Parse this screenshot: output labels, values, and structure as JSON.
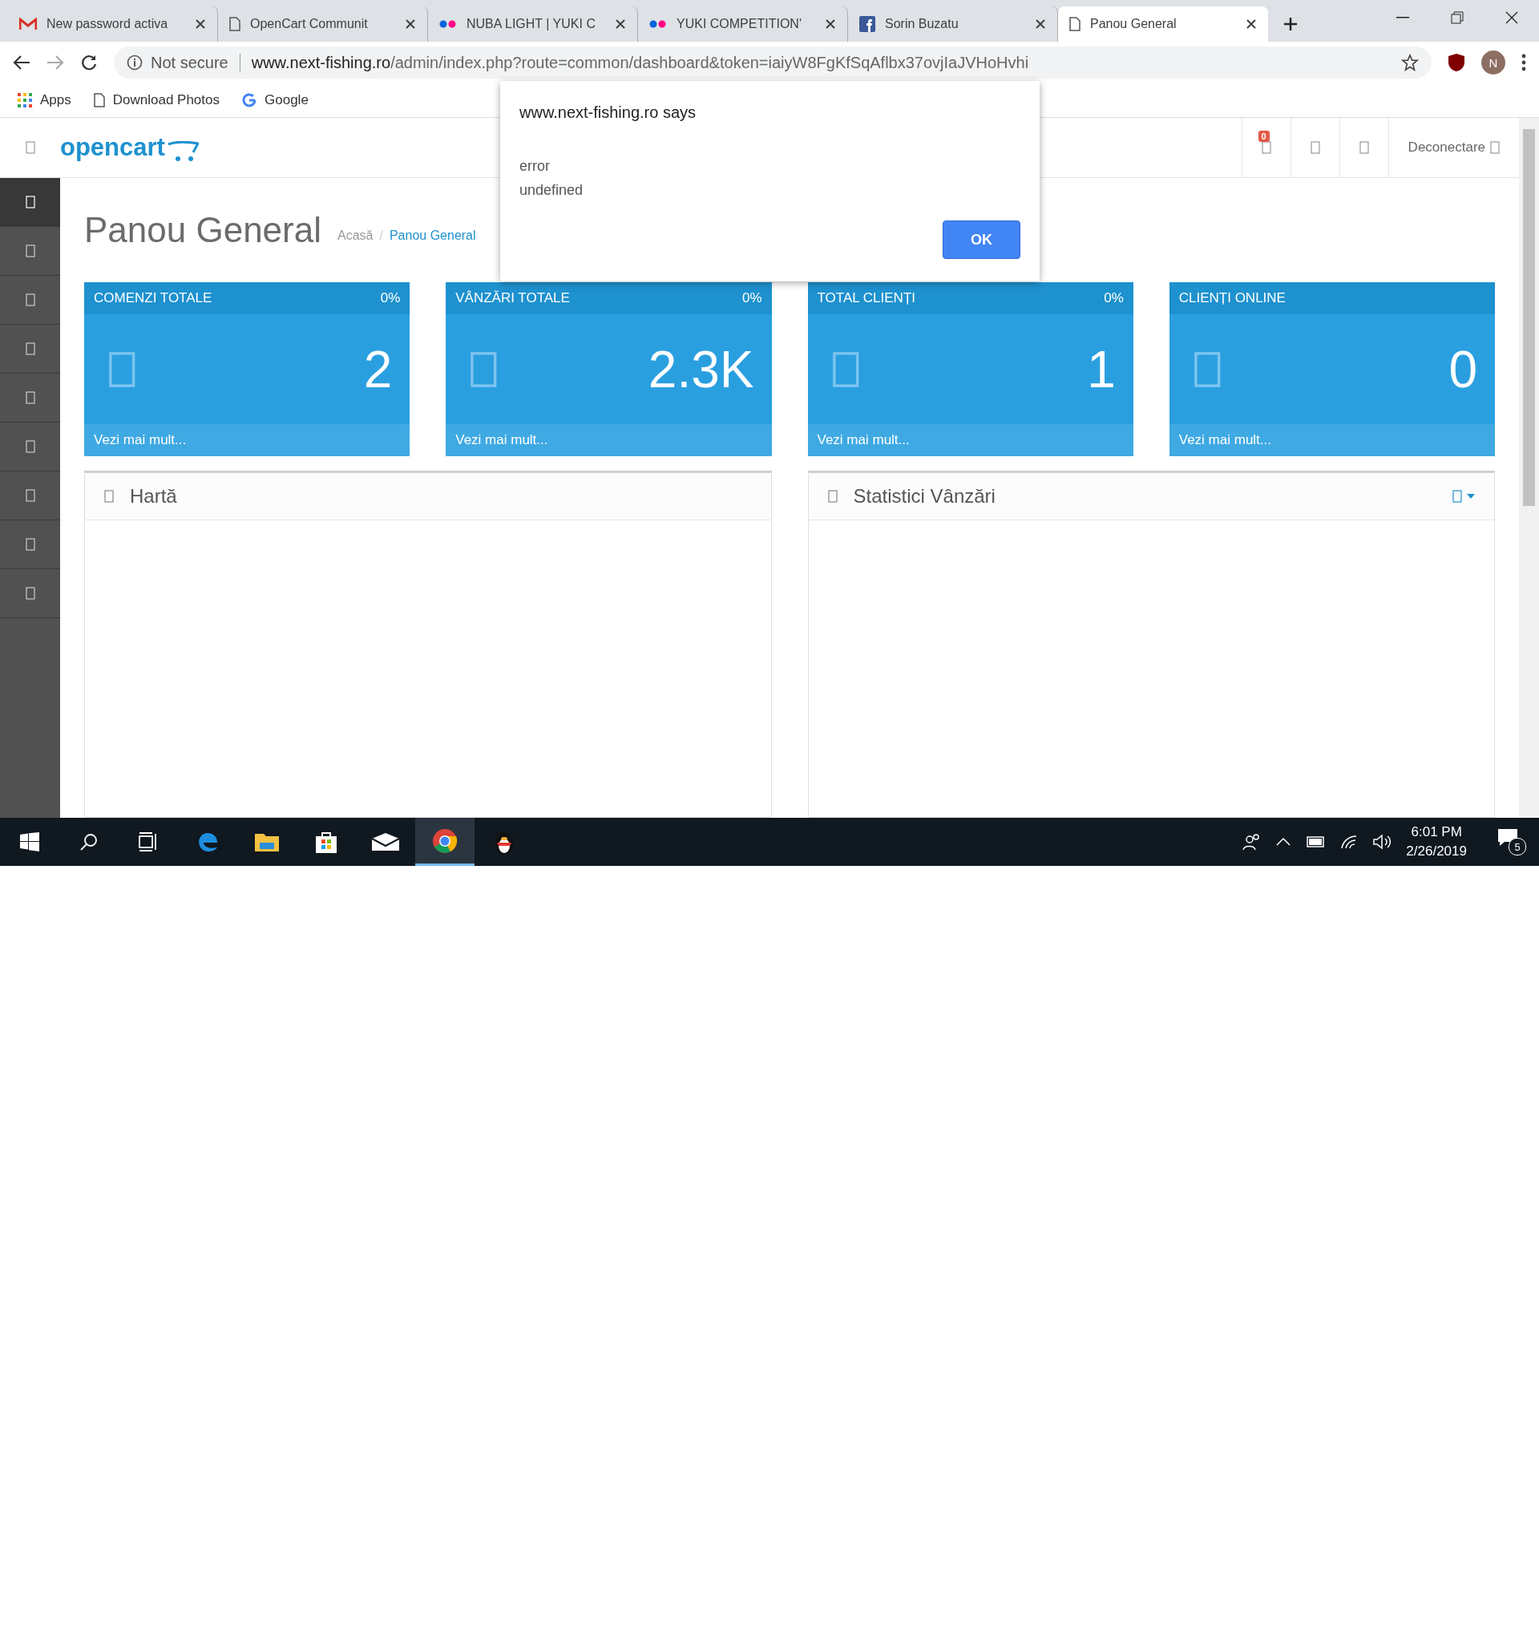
{
  "browser": {
    "tabs": [
      {
        "title": "New password activa",
        "selected": false
      },
      {
        "title": "OpenCart Communit",
        "selected": false
      },
      {
        "title": "NUBA LIGHT | YUKI C",
        "selected": false
      },
      {
        "title": "YUKI COMPETITION'",
        "selected": false
      },
      {
        "title": "Sorin Buzatu",
        "selected": false
      },
      {
        "title": "Panou General",
        "selected": true
      }
    ],
    "security": "Not secure",
    "url_host": "www.next-fishing.ro",
    "url_path": "/admin/index.php?route=common/dashboard&token=iaiyW8FgKfSqAflbx37ovjIaJVHoHvhi",
    "profile": "N",
    "bookmarks": [
      {
        "label": "Apps"
      },
      {
        "label": "Download Photos"
      },
      {
        "label": "Google"
      }
    ]
  },
  "header": {
    "logo": "opencart",
    "notifications": "0",
    "logout": "Deconectare"
  },
  "sidebar": {
    "items": [
      {
        "selected": true
      },
      {
        "selected": false
      },
      {
        "selected": false
      },
      {
        "selected": false
      },
      {
        "selected": false
      },
      {
        "selected": false
      },
      {
        "selected": false
      },
      {
        "selected": false
      },
      {
        "selected": false
      }
    ]
  },
  "page": {
    "title": "Panou General",
    "separator": "/",
    "breadcrumbs": [
      {
        "label": "Acasă",
        "selected": false
      },
      {
        "label": "Panou General",
        "selected": true
      }
    ]
  },
  "cards": [
    {
      "title": "COMENZI TOTALE",
      "percent": "0%",
      "value": "2",
      "link": "Vezi mai mult..."
    },
    {
      "title": "VÂNZĂRI TOTALE",
      "percent": "0%",
      "value": "2.3K",
      "link": "Vezi mai mult..."
    },
    {
      "title": "TOTAL CLIENȚI",
      "percent": "0%",
      "value": "1",
      "link": "Vezi mai mult..."
    },
    {
      "title": "CLIENȚI ONLINE",
      "value": "0",
      "link": "Vezi mai mult..."
    }
  ],
  "panels": [
    {
      "title": "Hartă",
      "menu": false
    },
    {
      "title": "Statistici Vânzări",
      "menu": true
    }
  ],
  "dialog": {
    "title": "www.next-fishing.ro says",
    "lines": [
      "error",
      "undefined"
    ],
    "button": "OK"
  },
  "taskbar": {
    "apps": [
      {
        "selected": false
      },
      {
        "selected": false
      },
      {
        "selected": false
      },
      {
        "selected": false
      },
      {
        "selected": true
      },
      {
        "selected": false
      }
    ],
    "time": "6:01 PM",
    "date": "2/26/2019",
    "notifications": "5"
  }
}
